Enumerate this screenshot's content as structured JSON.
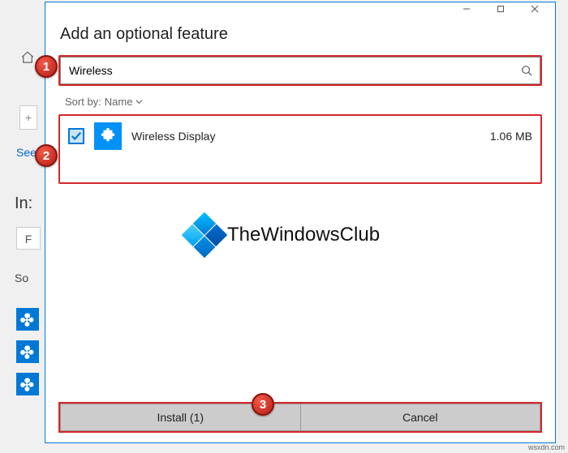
{
  "bg": {
    "see_text": "See",
    "ins_text": "In:",
    "f_text": "F",
    "so_text": "So"
  },
  "modal": {
    "title": "Add an optional feature",
    "search_value": "Wireless",
    "search_placeholder": "",
    "sort_label": "Sort by:",
    "sort_value": "Name"
  },
  "results": [
    {
      "name": "Wireless Display",
      "size": "1.06 MB",
      "checked": true
    }
  ],
  "watermark": "TheWindowsClub",
  "buttons": {
    "install": "Install (1)",
    "cancel": "Cancel"
  },
  "callouts": {
    "c1": "1",
    "c2": "2",
    "c3": "3"
  },
  "attribution": "wsxdn.com"
}
